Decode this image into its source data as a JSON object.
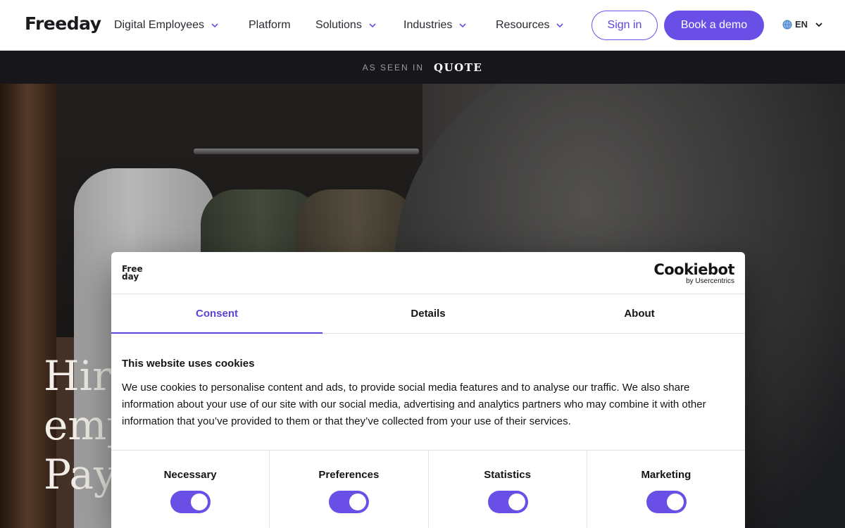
{
  "nav": {
    "logo": "Freeday",
    "items": [
      {
        "label": "Digital Employees",
        "has_dropdown": true
      },
      {
        "label": "Platform",
        "has_dropdown": false
      },
      {
        "label": "Solutions",
        "has_dropdown": true
      },
      {
        "label": "Industries",
        "has_dropdown": true
      },
      {
        "label": "Resources",
        "has_dropdown": true
      }
    ],
    "sign_in": "Sign in",
    "book_demo": "Book a demo",
    "language": "EN",
    "accent_color": "#6a4fe7"
  },
  "press": {
    "label": "AS SEEN IN",
    "logo": "QUOTE"
  },
  "hero": {
    "headline_lines": [
      "Hire",
      "emp",
      "Pay"
    ]
  },
  "cookie_dialog": {
    "brand_logo_top": "Free",
    "brand_logo_bottom": "day",
    "provider_logo": "Cookiebot",
    "provider_sub": "by Usercentrics",
    "tabs": [
      {
        "label": "Consent",
        "active": true
      },
      {
        "label": "Details",
        "active": false
      },
      {
        "label": "About",
        "active": false
      }
    ],
    "title": "This website uses cookies",
    "body": "We use cookies to personalise content and ads, to provide social media features and to analyse our traffic. We also share information about your use of our site with our social media, advertising and analytics partners who may combine it with other information that you’ve provided to them or that they’ve collected from your use of their services.",
    "categories": [
      {
        "label": "Necessary",
        "enabled": true
      },
      {
        "label": "Preferences",
        "enabled": true
      },
      {
        "label": "Statistics",
        "enabled": true
      },
      {
        "label": "Marketing",
        "enabled": true
      }
    ]
  }
}
